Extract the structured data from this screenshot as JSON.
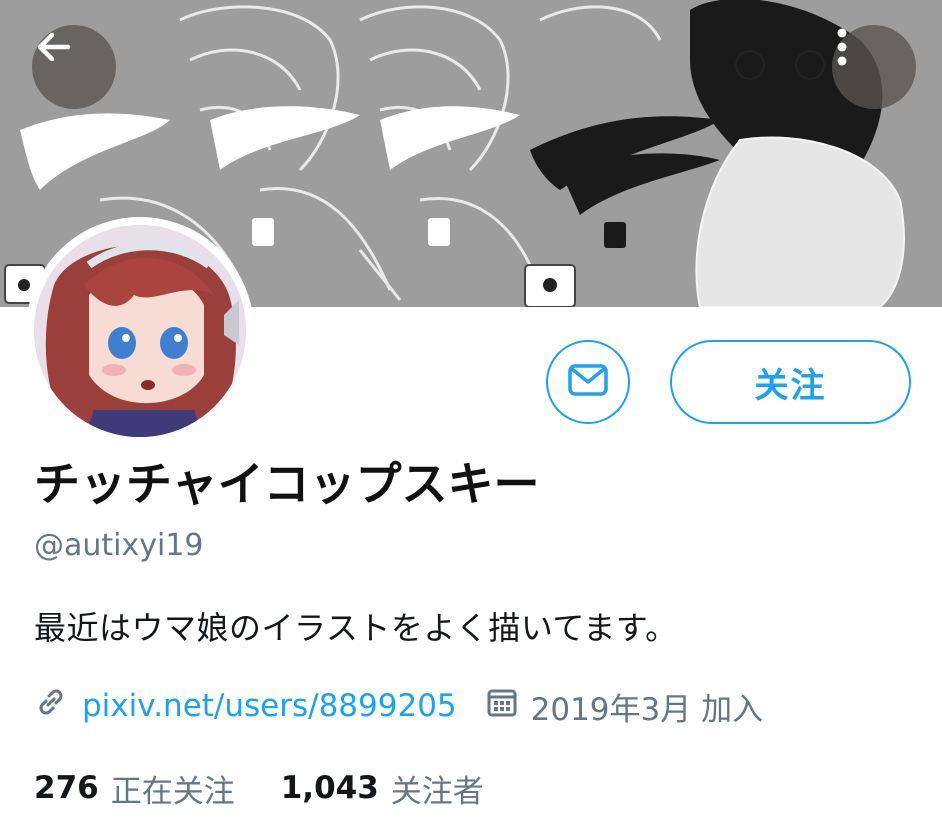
{
  "header": {
    "back_icon": "arrow-left-icon",
    "more_icon": "more-vertical-icon"
  },
  "profile": {
    "display_name": "チッチャイコップスキー",
    "handle": "@autixyi19",
    "bio": "最近はウマ娘のイラストをよく描いてます。",
    "link": "pixiv.net/users/8899205",
    "joined": "2019年3月 加入",
    "following_count": "276",
    "following_label": "正在关注",
    "followers_count": "1,043",
    "followers_label": "关注者"
  },
  "actions": {
    "follow_label": "关注",
    "message_icon": "mail-icon"
  },
  "colors": {
    "accent": "#1da1f2",
    "secondary_text": "#657786",
    "banner_gray": "#9c9c9c"
  }
}
